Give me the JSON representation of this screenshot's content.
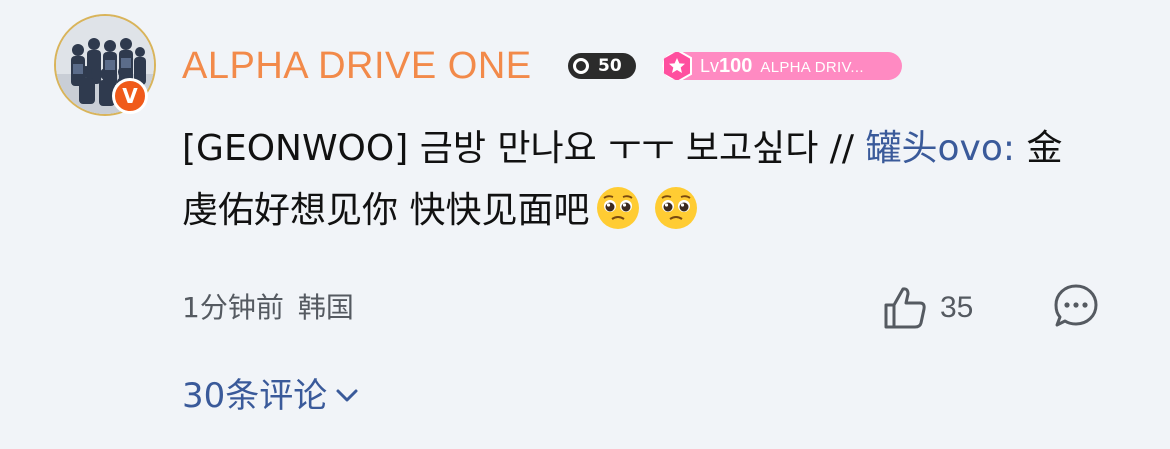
{
  "comment": {
    "username": "ALPHA DRIVE ONE",
    "verified_badge": "V",
    "badges": {
      "s_badge": "50",
      "level_prefix": "Lv",
      "level_number": "100",
      "level_group": "ALPHA DRIV..."
    },
    "body": {
      "text": "[GEONWOO] 금방 만나요 ㅜㅜ 보고싶다 // ",
      "mention": "罐头ovo:",
      "quote": " 金虔佑好想见你 快快见面吧",
      "emojis": [
        "pleading-face-emoji",
        "pleading-face-emoji"
      ]
    },
    "meta": {
      "time": "1分钟前",
      "region": "韩国"
    },
    "like_count": "35",
    "more_comments": "30条评论"
  },
  "colors": {
    "username": "#f28a4a",
    "mention": "#3a5a9a",
    "level_badge": "#ff8ac2",
    "verified": "#f05a1a",
    "background": "#f1f4f8"
  },
  "icons": [
    "avatar",
    "verified-v-icon",
    "s-badge-icon",
    "level-star-icon",
    "thumbs-up-icon",
    "comment-bubble-icon",
    "chevron-down-icon"
  ]
}
